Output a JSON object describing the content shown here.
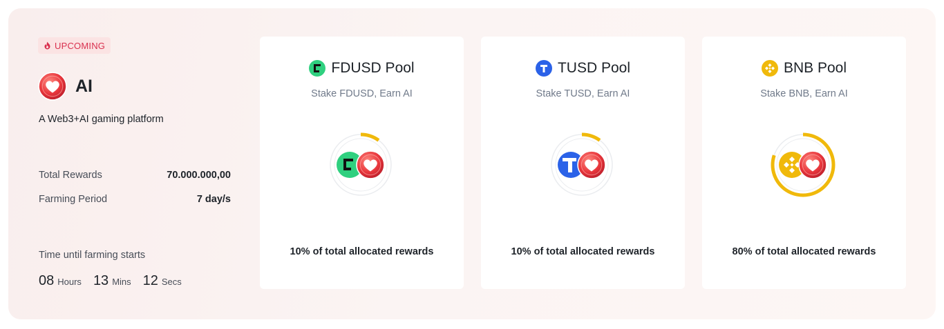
{
  "project": {
    "status_badge": "UPCOMING",
    "name": "AI",
    "description": "A Web3+AI gaming platform",
    "stats": [
      {
        "label": "Total Rewards",
        "value": "70.000.000,00"
      },
      {
        "label": "Farming Period",
        "value": "7 day/s"
      }
    ],
    "countdown": {
      "label": "Time until farming starts",
      "hours": "08",
      "hours_unit": "Hours",
      "mins": "13",
      "mins_unit": "Mins",
      "secs": "12",
      "secs_unit": "Secs"
    }
  },
  "pools": [
    {
      "title": "FDUSD Pool",
      "subtitle": "Stake FDUSD, Earn AI",
      "share_text": "10%  of total allocated rewards",
      "share": 0.1,
      "token_icon": "fdusd-icon",
      "token_color": "#2fd07f"
    },
    {
      "title": "TUSD Pool",
      "subtitle": "Stake TUSD, Earn AI",
      "share_text": "10%  of total allocated rewards",
      "share": 0.1,
      "token_icon": "tusd-icon",
      "token_color": "#2b62e8"
    },
    {
      "title": "BNB Pool",
      "subtitle": "Stake BNB, Earn AI",
      "share_text": "80%  of total allocated rewards",
      "share": 0.8,
      "token_icon": "bnb-icon",
      "token_color": "#f0b90b"
    }
  ],
  "colors": {
    "accent": "#f0b90b",
    "badge_text": "#d9304e",
    "ring_track": "#eaecef"
  }
}
